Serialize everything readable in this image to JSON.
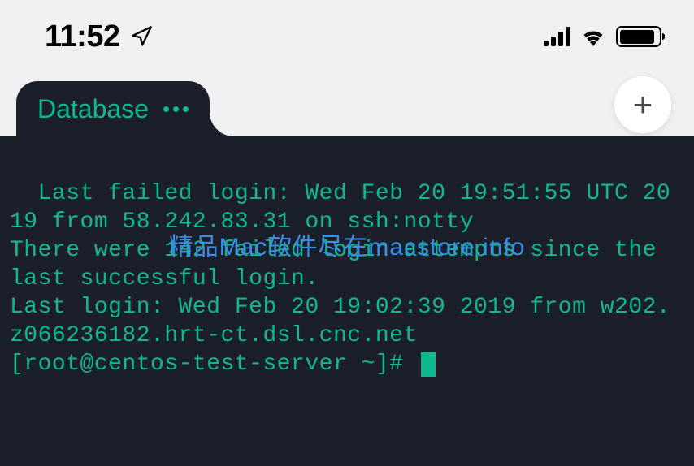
{
  "status_bar": {
    "time": "11:52"
  },
  "tab": {
    "label": "Database"
  },
  "terminal": {
    "line1": "Last failed login: Wed Feb 20 19:51:55 UTC 2019 from 58.242.83.31 on ssh:notty",
    "line2": "There were 142 failed login attempts since the last successful login.",
    "line3": "Last login: Wed Feb 20 19:02:39 2019 from w202.z066236182.hrt-ct.dsl.cnc.net",
    "prompt": "[root@centos-test-server ~]# "
  },
  "watermark": "精品Mac软件尽在macstore.info"
}
